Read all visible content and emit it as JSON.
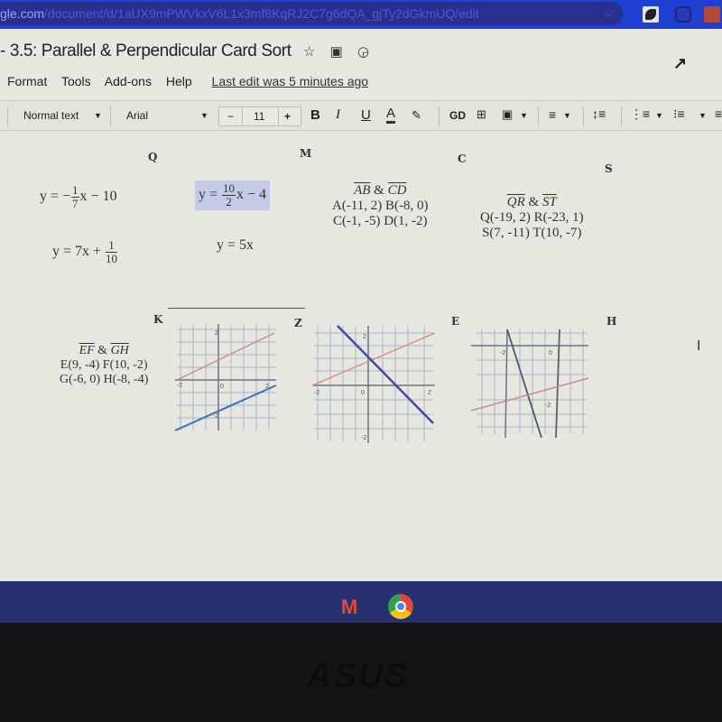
{
  "browser": {
    "url_host": "gle.com",
    "url_path": "/document/d/1aUX9mPWVkxV6L1x3mf8KqRJ2C7g6dQA_gjTy2dGkmUQ/edit"
  },
  "doc": {
    "title": "3.5: Parallel & Perpendicular Card Sort",
    "title_icons": [
      "star-icon",
      "move-to-folder-icon",
      "cloud-status-icon"
    ],
    "activity_icon": "↗",
    "menu": [
      "Format",
      "Tools",
      "Add-ons",
      "Help"
    ],
    "last_edit": "Last edit was 5 minutes ago"
  },
  "toolbar": {
    "style": "Normal text",
    "font": "Arial",
    "font_size": "11",
    "minus": "−",
    "plus": "+",
    "bold": "B",
    "italic": "I",
    "underline": "U",
    "text_color": "A"
  },
  "cards": {
    "labels": [
      "Q",
      "M",
      "C",
      "S",
      "K",
      "Z",
      "E",
      "H"
    ],
    "q_eq1": {
      "prefix": "y = −",
      "num": "1",
      "den": "7",
      "suffix": "x − 10"
    },
    "m_eq1": {
      "prefix": "y = ",
      "num": "10",
      "den": "2",
      "suffix": "x − 4"
    },
    "q_eq2": {
      "prefix": "y = 7x + ",
      "num": "1",
      "den": "10"
    },
    "m_eq2": "y = 5x",
    "c_points": {
      "lines": [
        "AB",
        "CD"
      ],
      "row1": "A(-11, 2)  B(-8, 0)",
      "row2": "C(-1, -5)  D(1, -2)"
    },
    "s_points": {
      "lines": [
        "QR",
        "ST"
      ],
      "row1": "Q(-19, 2)  R(-23, 1)",
      "row2": "S(7, -11)  T(10, -7)"
    },
    "k_points": {
      "lines": [
        "EF",
        "GH"
      ],
      "row1": "E(9, -4)  F(10, -2)",
      "row2": "G(-6, 0)  H(-8, -4)"
    },
    "amp": "&"
  },
  "graphs": {
    "z_graph": {
      "ticks": [
        "2",
        "-2",
        "0",
        "2",
        "-2"
      ]
    },
    "e_graph": {
      "ticks": [
        "-2",
        "0",
        "-2"
      ]
    },
    "h_graph": {
      "ticks": [
        "2",
        "0",
        "-2"
      ]
    }
  },
  "shelf": {
    "gmail": "M"
  },
  "bezel": {
    "brand": "ASUS"
  }
}
